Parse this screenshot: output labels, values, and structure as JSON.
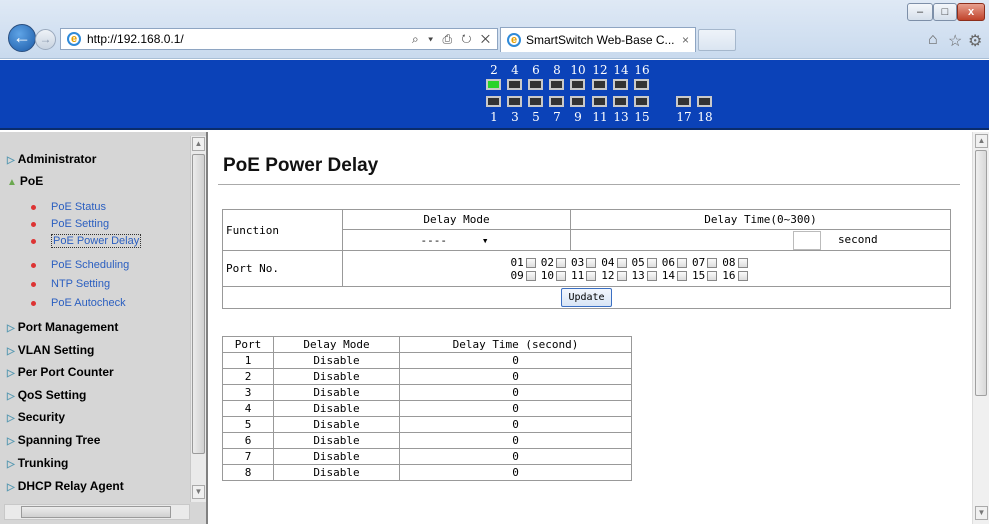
{
  "browser": {
    "url": "http://192.168.0.1/",
    "address_tools": "⌕ ▾ ⎙ ↻ ✕",
    "tab_title": "SmartSwitch Web-Base C...",
    "tab_close": "×",
    "window_buttons": {
      "minimize": "–",
      "maximize": "□",
      "close": "x"
    }
  },
  "ports_top": [
    "2",
    "4",
    "6",
    "8",
    "10",
    "12",
    "14",
    "16"
  ],
  "ports_bottom": [
    "1",
    "3",
    "5",
    "7",
    "9",
    "11",
    "13",
    "15",
    "17",
    "18"
  ],
  "active_port": "2",
  "sidebar": {
    "menus": [
      {
        "label": "Administrator"
      },
      {
        "label": "PoE"
      },
      {
        "label": "Port Management"
      },
      {
        "label": "VLAN Setting"
      },
      {
        "label": "Per Port Counter"
      },
      {
        "label": "QoS Setting"
      },
      {
        "label": "Security"
      },
      {
        "label": "Spanning Tree"
      },
      {
        "label": "Trunking"
      },
      {
        "label": "DHCP Relay Agent"
      }
    ],
    "poe_items": [
      {
        "label": "PoE Status"
      },
      {
        "label": "PoE Setting"
      },
      {
        "label": "PoE Power Delay"
      },
      {
        "label": "PoE Scheduling"
      },
      {
        "label": "NTP Setting"
      },
      {
        "label": "PoE Autocheck"
      }
    ]
  },
  "page": {
    "title": "PoE Power Delay",
    "form": {
      "function_label": "Function",
      "delay_mode_label": "Delay Mode",
      "delay_time_label": "Delay Time(0~300)",
      "delay_mode_value": "----",
      "delay_time_value": "",
      "second_label": "second",
      "port_no_label": "Port No.",
      "ports_row1": [
        "01",
        "02",
        "03",
        "04",
        "05",
        "06",
        "07",
        "08"
      ],
      "ports_row2": [
        "09",
        "10",
        "11",
        "12",
        "13",
        "14",
        "15",
        "16"
      ],
      "update_label": "Update"
    },
    "table": {
      "headers": [
        "Port",
        "Delay Mode",
        "Delay Time (second)"
      ],
      "rows": [
        [
          "1",
          "Disable",
          "0"
        ],
        [
          "2",
          "Disable",
          "0"
        ],
        [
          "3",
          "Disable",
          "0"
        ],
        [
          "4",
          "Disable",
          "0"
        ],
        [
          "5",
          "Disable",
          "0"
        ],
        [
          "6",
          "Disable",
          "0"
        ],
        [
          "7",
          "Disable",
          "0"
        ],
        [
          "8",
          "Disable",
          "0"
        ]
      ]
    }
  },
  "colors": {
    "banner": "#0b42b8",
    "active_port": "#2ad32a",
    "link": "#2b5fc0"
  }
}
